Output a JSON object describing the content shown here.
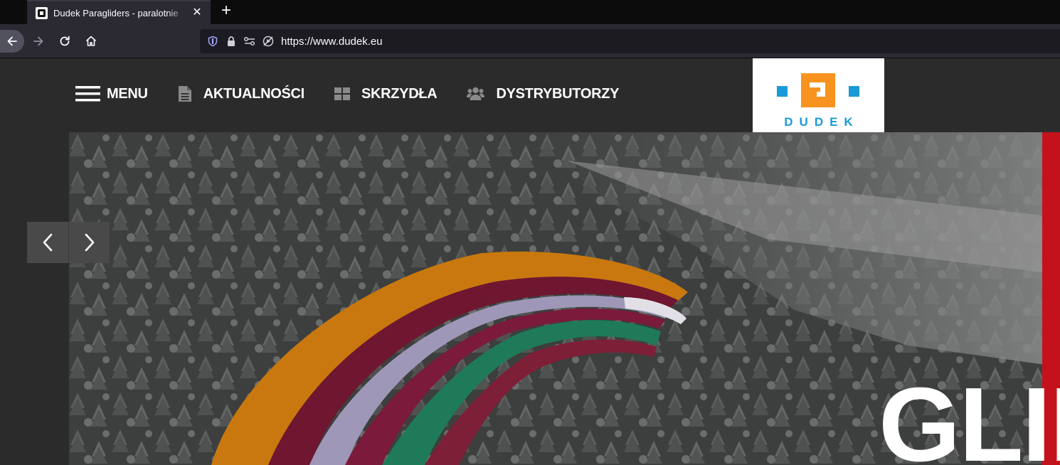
{
  "browser": {
    "tab": {
      "title": "Dudek Paragliders - paralotnie",
      "close_icon": "close-icon"
    },
    "new_tab_icon": "plus-icon",
    "url": "https://www.dudek.eu"
  },
  "site": {
    "nav": {
      "menu_label": "MENU",
      "news_label": "AKTUALNOŚCI",
      "wings_label": "SKRZYDŁA",
      "distributors_label": "DYSTRYBUTORZY"
    },
    "logo_text": "DUDEK",
    "hero": {
      "title_partial": "GLID"
    },
    "colors": {
      "logo_orange": "#f7931e",
      "logo_blue": "#1a9ad6",
      "accent_red": "#c4121c"
    }
  }
}
